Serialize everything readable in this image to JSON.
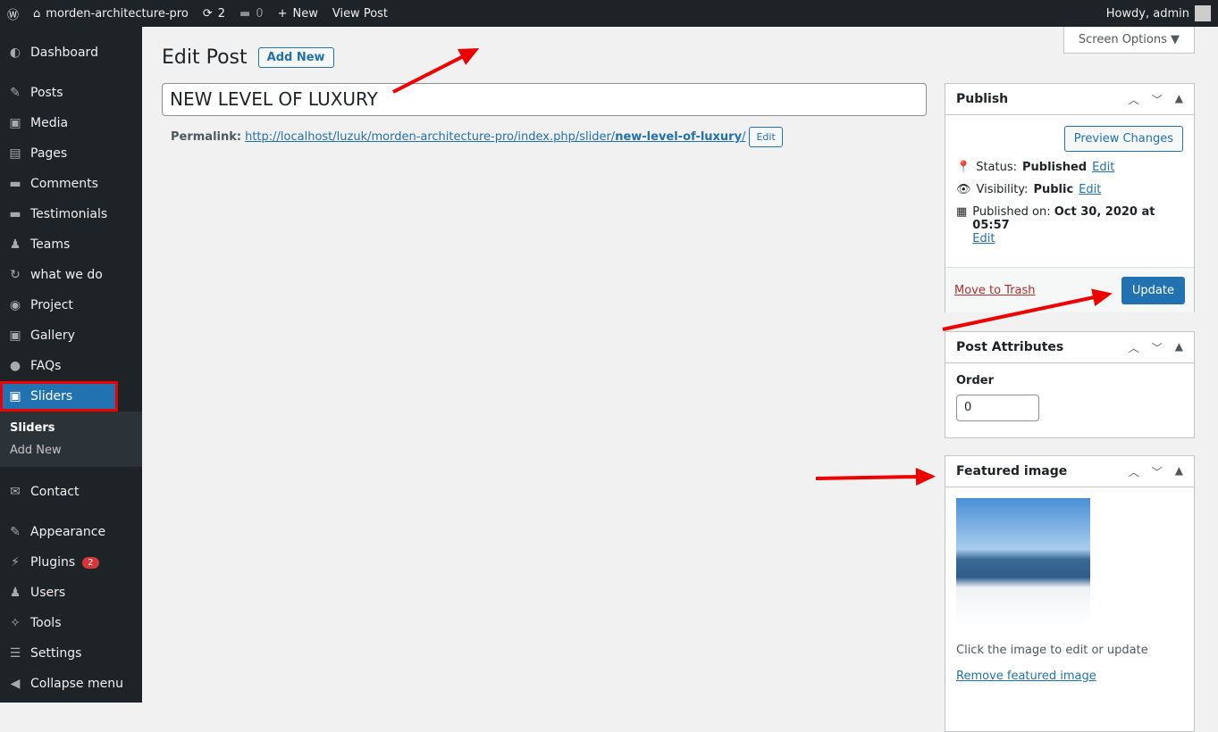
{
  "adminbar": {
    "site": "morden-architecture-pro",
    "updates": "2",
    "comments": "0",
    "new": "New",
    "view": "View Post",
    "howdy": "Howdy, admin"
  },
  "menu": [
    {
      "icon": "◐",
      "label": "Dashboard"
    },
    {
      "icon": "✎",
      "label": "Posts"
    },
    {
      "icon": "▣",
      "label": "Media"
    },
    {
      "icon": "▤",
      "label": "Pages"
    },
    {
      "icon": "▬",
      "label": "Comments"
    },
    {
      "icon": "▬",
      "label": "Testimonials"
    },
    {
      "icon": "♟",
      "label": "Teams"
    },
    {
      "icon": "↻",
      "label": "what we do"
    },
    {
      "icon": "◉",
      "label": "Project"
    },
    {
      "icon": "▣",
      "label": "Gallery"
    },
    {
      "icon": "●",
      "label": "FAQs"
    },
    {
      "icon": "▣",
      "label": "Sliders"
    },
    {
      "icon": "✉",
      "label": "Contact"
    },
    {
      "icon": "✎",
      "label": "Appearance"
    },
    {
      "icon": "⚡",
      "label": "Plugins",
      "badge": "2"
    },
    {
      "icon": "♟",
      "label": "Users"
    },
    {
      "icon": "✧",
      "label": "Tools"
    },
    {
      "icon": "☰",
      "label": "Settings"
    },
    {
      "icon": "◀",
      "label": "Collapse menu"
    }
  ],
  "submenu": [
    "Sliders",
    "Add New"
  ],
  "page": {
    "heading": "Edit Post",
    "add_new": "Add New",
    "title": "NEW LEVEL OF LUXURY",
    "permalink_label": "Permalink:",
    "permalink_base": "http://localhost/luzuk/morden-architecture-pro/index.php/slider/",
    "permalink_slug": "new-level-of-luxury",
    "permalink_end": "/",
    "edit": "Edit",
    "screen_options": "Screen Options ▼"
  },
  "publish": {
    "title": "Publish",
    "preview": "Preview Changes",
    "status_label": "Status:",
    "status": "Published",
    "visibility_label": "Visibility:",
    "visibility": "Public",
    "published_label": "Published on:",
    "published": "Oct 30, 2020 at 05:57",
    "edit": "Edit",
    "trash": "Move to Trash",
    "update": "Update"
  },
  "attributes": {
    "title": "Post Attributes",
    "order_label": "Order",
    "order": "0"
  },
  "featured": {
    "title": "Featured image",
    "hint": "Click the image to edit or update",
    "remove": "Remove featured image"
  }
}
